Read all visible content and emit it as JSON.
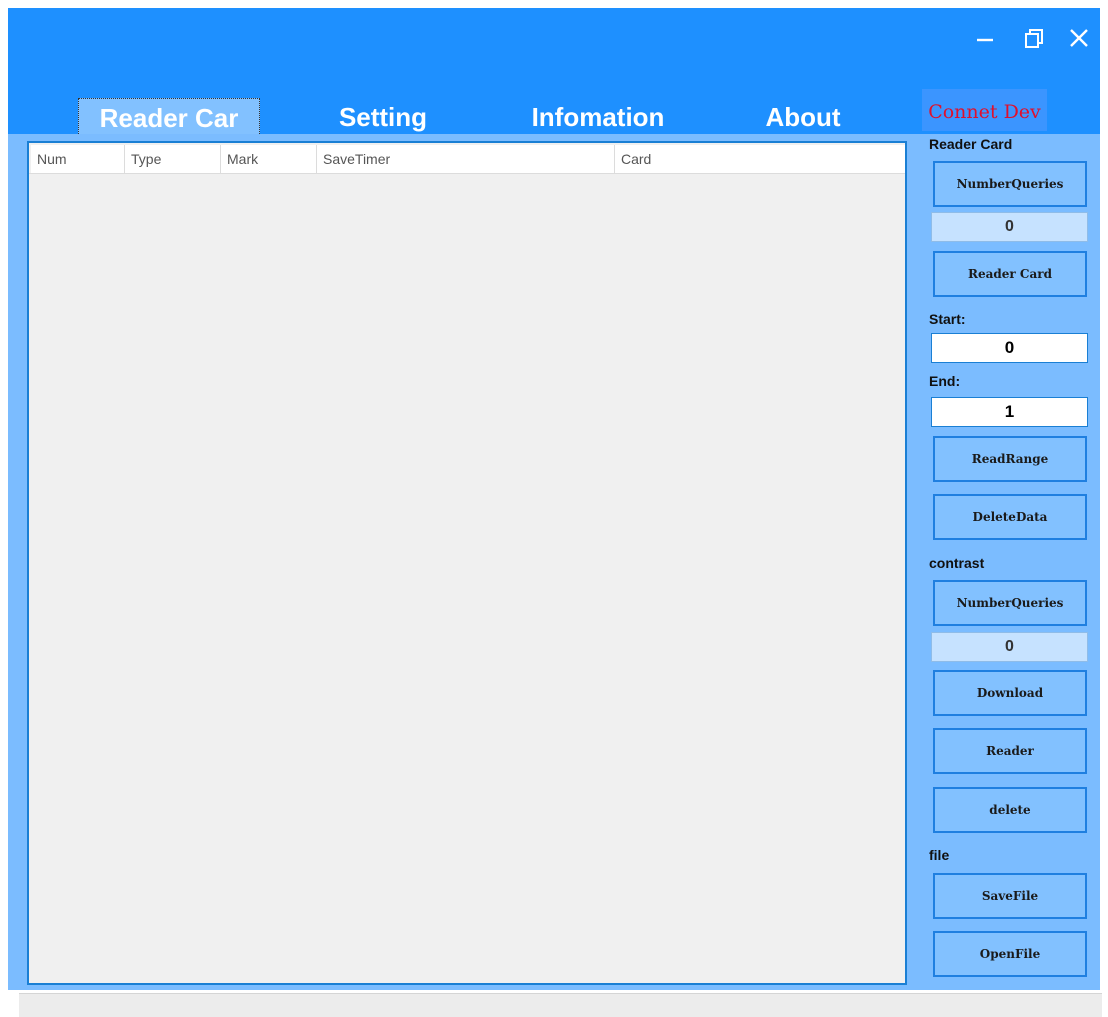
{
  "window": {
    "controls": [
      "minimize-icon",
      "restore-icon",
      "close-icon"
    ]
  },
  "tabs": [
    {
      "label": "Reader Car",
      "active": true
    },
    {
      "label": "Setting",
      "active": false
    },
    {
      "label": "Infomation",
      "active": false
    },
    {
      "label": "About",
      "active": false
    }
  ],
  "connect_button": "Connet Dev",
  "table": {
    "columns": [
      "Num",
      "Type",
      "Mark",
      "SaveTimer",
      "Card"
    ],
    "rows": []
  },
  "reader_card": {
    "title": "Reader Card",
    "number_queries_label": "NumberQueries",
    "count": "0",
    "reader_card_label": "Reader Card",
    "start_label": "Start:",
    "start_value": "0",
    "end_label": "End:",
    "end_value": "1",
    "read_range_label": "ReadRange",
    "delete_data_label": "DeleteData"
  },
  "contrast": {
    "title": "contrast",
    "number_queries_label": "NumberQueries",
    "count": "0",
    "download_label": "Download",
    "reader_label": "Reader",
    "delete_label": "delete"
  },
  "file": {
    "title": "file",
    "save_label": "SaveFile",
    "open_label": "OpenFile"
  },
  "colors": {
    "title_bar": "#1e90ff",
    "panel": "#7bbcff",
    "button": "#82c1ff",
    "button_border": "#1f7fe0",
    "connect_text": "#e0102c"
  }
}
